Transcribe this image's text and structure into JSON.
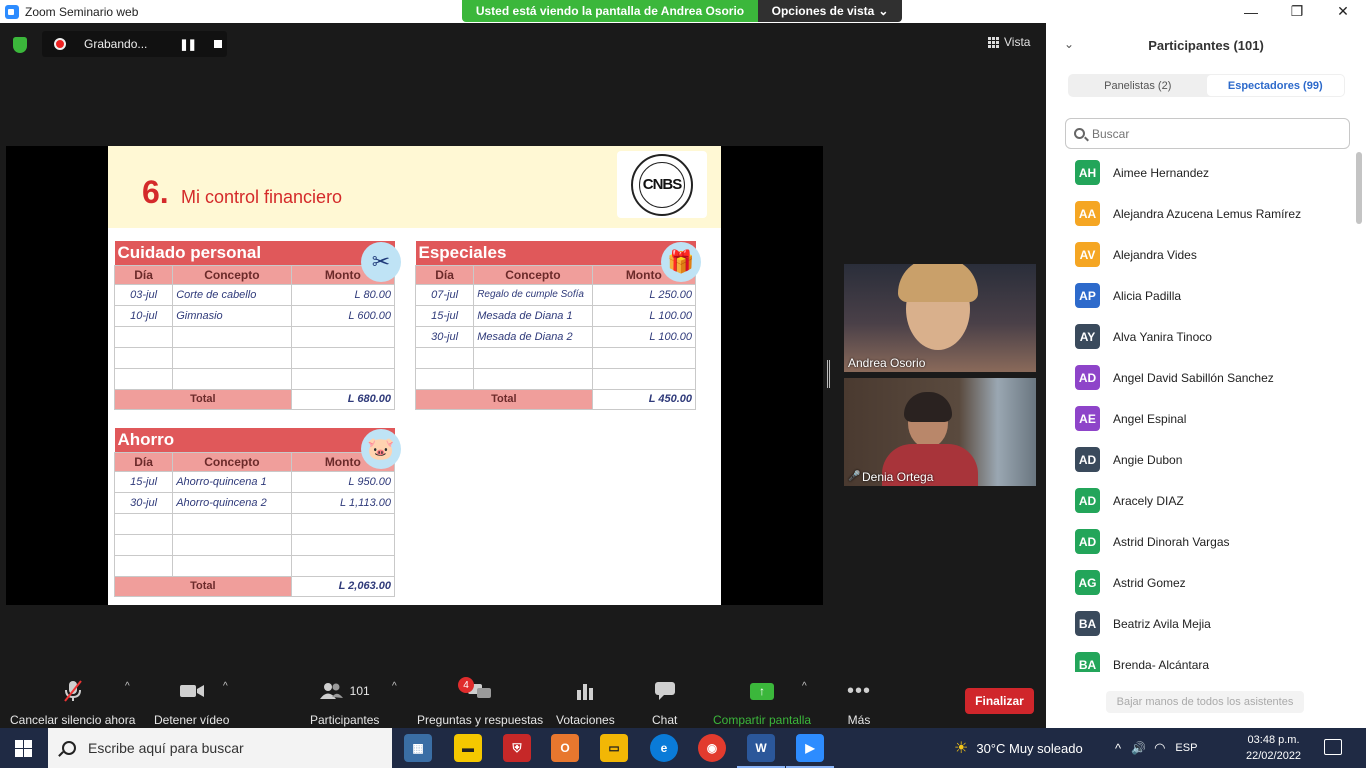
{
  "window": {
    "title": "Zoom Seminario web",
    "controls": {
      "minimize": "—",
      "maximize": "❐",
      "close": "✕"
    }
  },
  "share_banner": {
    "message": "Usted está viendo la pantalla de Andrea Osorio",
    "options_label": "Opciones de vista",
    "options_caret": "⌄"
  },
  "recording": {
    "label": "Grabando...",
    "pause": "❚❚"
  },
  "view_button": "Vista",
  "slide": {
    "number": "6.",
    "title": "Mi control financiero",
    "logo_text": "CNBS",
    "tables": [
      {
        "title": "Cuidado personal",
        "icon": "scissors-icon",
        "icon_glyph": "✂",
        "columns": [
          "Día",
          "Concepto",
          "Monto"
        ],
        "rows": [
          [
            "03-jul",
            "Corte de cabello",
            "L 80.00"
          ],
          [
            "10-jul",
            "Gimnasio",
            "L 600.00"
          ],
          [
            "",
            "",
            ""
          ],
          [
            "",
            "",
            ""
          ],
          [
            "",
            "",
            ""
          ]
        ],
        "total_label": "Total",
        "total": "L 680.00"
      },
      {
        "title": "Especiales",
        "icon": "gift-icon",
        "icon_glyph": "🎁",
        "columns": [
          "Día",
          "Concepto",
          "Monto"
        ],
        "rows": [
          [
            "07-jul",
            "Regalo de cumple Sofía",
            "L 250.00"
          ],
          [
            "15-jul",
            "Mesada de Diana 1",
            "L 100.00"
          ],
          [
            "30-jul",
            "Mesada de Diana 2",
            "L 100.00"
          ],
          [
            "",
            "",
            ""
          ],
          [
            "",
            "",
            ""
          ]
        ],
        "total_label": "Total",
        "total": "L 450.00"
      },
      {
        "title": "Ahorro",
        "icon": "piggy-bank-icon",
        "icon_glyph": "🐷",
        "columns": [
          "Día",
          "Concepto",
          "Monto"
        ],
        "rows": [
          [
            "15-jul",
            "Ahorro-quincena 1",
            "L 950.00"
          ],
          [
            "30-jul",
            "Ahorro-quincena 2",
            "L 1,113.00"
          ],
          [
            "",
            "",
            ""
          ],
          [
            "",
            "",
            ""
          ],
          [
            "",
            "",
            ""
          ]
        ],
        "total_label": "Total",
        "total": "L 2,063.00"
      }
    ]
  },
  "gallery": [
    {
      "name": "Andrea Osorio",
      "muted": false
    },
    {
      "name": "Denia Ortega",
      "muted": true
    }
  ],
  "toolbar": {
    "mute": "Cancelar silencio ahora",
    "video": "Detener vídeo",
    "participants": "Participantes",
    "participants_count": "101",
    "qa": "Preguntas y respuestas",
    "qa_badge": "4",
    "polls": "Votaciones",
    "chat": "Chat",
    "share": "Compartir pantalla",
    "more": "Más",
    "end": "Finalizar",
    "caret": "^"
  },
  "panel": {
    "title": "Participantes (101)",
    "chevron": "⌄",
    "tabs": [
      {
        "label": "Panelistas (2)",
        "active": false
      },
      {
        "label": "Espectadores (99)",
        "active": true
      }
    ],
    "search_placeholder": "Buscar",
    "participants": [
      {
        "initials": "AH",
        "name": "Aimee Hernandez",
        "color": "#23a55a"
      },
      {
        "initials": "AA",
        "name": "Alejandra Azucena Lemus Ramírez",
        "color": "#f5a623"
      },
      {
        "initials": "AV",
        "name": "Alejandra Vides",
        "color": "#f5a623"
      },
      {
        "initials": "AP",
        "name": "Alicia Padilla",
        "color": "#2d6acb"
      },
      {
        "initials": "AY",
        "name": "Alva Yanira Tinoco",
        "color": "#3a4a5c"
      },
      {
        "initials": "AD",
        "name": "Angel David Sabillón Sanchez",
        "color": "#8e44c9"
      },
      {
        "initials": "AE",
        "name": "Angel Espinal",
        "color": "#8e44c9"
      },
      {
        "initials": "AD",
        "name": "Angie Dubon",
        "color": "#3a4a5c"
      },
      {
        "initials": "AD",
        "name": "Aracely DIAZ",
        "color": "#23a55a"
      },
      {
        "initials": "AD",
        "name": "Astrid Dinorah Vargas",
        "color": "#23a55a"
      },
      {
        "initials": "AG",
        "name": "Astrid Gomez",
        "color": "#23a55a"
      },
      {
        "initials": "BA",
        "name": "Beatriz Avila Mejia",
        "color": "#3a4a5c"
      },
      {
        "initials": "BA",
        "name": "Brenda- Alcántara",
        "color": "#23a55a"
      }
    ],
    "lower_hands": "Bajar manos de todos los asistentes"
  },
  "taskbar": {
    "search_placeholder": "Escribe aquí para buscar",
    "weather": "30°C  Muy soleado",
    "lang": "ESP",
    "time": "03:48 p.m.",
    "date": "22/02/2022",
    "tray_caret": "^",
    "volume": "🔊"
  }
}
